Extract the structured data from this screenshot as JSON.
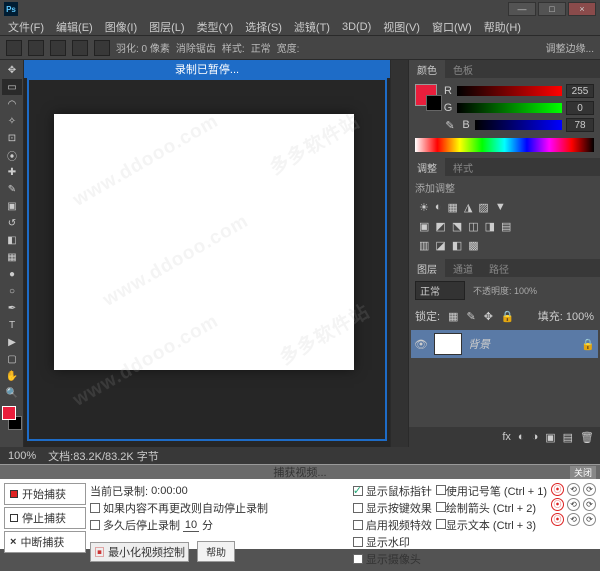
{
  "titlebar": {
    "ps": "Ps"
  },
  "winbtns": {
    "min": "—",
    "max": "□",
    "close": "×"
  },
  "menubar": [
    "文件(F)",
    "编辑(E)",
    "图像(I)",
    "图层(L)",
    "类型(Y)",
    "选择(S)",
    "滤镜(T)",
    "3D(D)",
    "视图(V)",
    "窗口(W)",
    "帮助(H)"
  ],
  "optbar": {
    "feather": "羽化: 0 像素",
    "antialias": "消除锯齿",
    "style": "样式:",
    "normal": "正常",
    "width": "宽度:",
    "adjust": "调整边缘..."
  },
  "rec": {
    "label": "录制已暂停..."
  },
  "panels": {
    "colorTabs": [
      "颜色",
      "色板"
    ],
    "sliders": [
      {
        "lbl": "R",
        "val": "255"
      },
      {
        "lbl": "G",
        "val": "0"
      },
      {
        "lbl": "B",
        "val": "78"
      }
    ],
    "adjustTabs": [
      "调整",
      "样式"
    ],
    "addAdjust": "添加调整",
    "layersTabs": [
      "图层",
      "通道",
      "路径"
    ],
    "blendMode": "正常",
    "opacity": "不透明度: 100%",
    "lock": "锁定:",
    "fill": "填充: 100%",
    "layerName": "背景"
  },
  "statusbar": {
    "zoom": "100%",
    "doc": "文档:83.2K/83.2K 字节"
  },
  "capture": {
    "title": "捕获视频...",
    "close": "关闭",
    "startCapture": "开始捕获",
    "stopCapture": "停止捕获",
    "interruptCapture": "中断捕获",
    "recordedLabel": "当前已录制:",
    "recordedTime": "0:00:00",
    "autoStop": "如果内容不再更改则自动停止录制",
    "longStop": "多久后停止录制",
    "longStopVal": "10",
    "longStopUnit": "分",
    "minimize": "最小化视频控制",
    "help": "帮助",
    "showCursor": "显示鼠标指针",
    "showKeys": "显示按键效果",
    "enableFx": "启用视频特效",
    "showWatermark": "显示水印",
    "showIme": "显示摄像头",
    "useMarker": "使用记号笔 (Ctrl + 1)",
    "drawArrow": "绘制箭头 (Ctrl + 2)",
    "showText": "显示文本 (Ctrl + 3)"
  },
  "watermarks": [
    "www.ddooo.com",
    "www.ddooo.com",
    "www.ddooo.com",
    "多多软件站",
    "多多软件站"
  ]
}
